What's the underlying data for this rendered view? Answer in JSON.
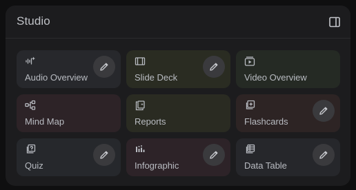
{
  "studio": {
    "title": "Studio",
    "toggle_icon": "panel-right-icon",
    "tiles": [
      {
        "label": "Audio Overview",
        "icon": "audio-waveform-sparkle-icon",
        "bg": "#27282c",
        "has_edit": true
      },
      {
        "label": "Slide Deck",
        "icon": "slides-icon",
        "bg": "#2a2c22",
        "has_edit": true
      },
      {
        "label": "Video Overview",
        "icon": "video-play-icon",
        "bg": "#252a24",
        "has_edit": false
      },
      {
        "label": "Mind Map",
        "icon": "mind-map-icon",
        "bg": "#2d2327",
        "has_edit": false
      },
      {
        "label": "Reports",
        "icon": "reports-icon",
        "bg": "#2a2b22",
        "has_edit": false
      },
      {
        "label": "Flashcards",
        "icon": "flashcards-icon",
        "bg": "#2d2424",
        "has_edit": true
      },
      {
        "label": "Quiz",
        "icon": "quiz-icon",
        "bg": "#26282c",
        "has_edit": true
      },
      {
        "label": "Infographic",
        "icon": "infographic-icon",
        "bg": "#2d2328",
        "has_edit": true
      },
      {
        "label": "Data Table",
        "icon": "data-table-icon",
        "bg": "#26272b",
        "has_edit": true
      }
    ],
    "colors": {
      "icon": "#b9bcc2",
      "edit_bg": "#3a3a3d",
      "panel_bg": "#1c1c1e"
    }
  }
}
